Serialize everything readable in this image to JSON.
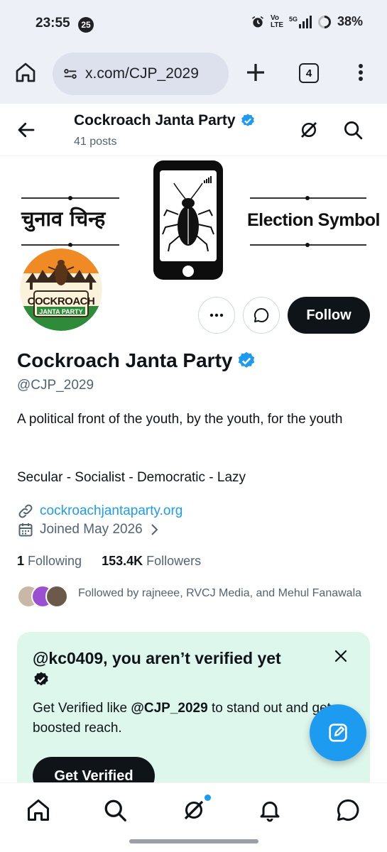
{
  "status_bar": {
    "time": "23:55",
    "notification_badge": "25",
    "network": "Vo LTE",
    "signal": "5G",
    "battery": "38%"
  },
  "browser": {
    "url": "x.com/CJP_2029",
    "tab_count": "4"
  },
  "header": {
    "name": "Cockroach Janta Party",
    "posts": "41 posts"
  },
  "banner": {
    "hindi_text": "चुनाव चिन्ह",
    "english_text": "Election Symbol"
  },
  "avatar": {
    "line1": "COCKROACH",
    "line2": "JANTA PARTY"
  },
  "actions": {
    "follow_label": "Follow"
  },
  "profile": {
    "name": "Cockroach Janta Party",
    "handle": "@CJP_2029",
    "bio": "A political front of the youth, by the youth, for the youth",
    "bio_line2": "Secular - Socialist - Democratic - Lazy",
    "website": "cockroachjantaparty.org",
    "joined": "Joined May 2026",
    "following_count": "1",
    "following_label": "Following",
    "followers_count": "153.4K",
    "followers_label": "Followers",
    "followed_by": "Followed by rajneee, RVCJ Media, and Mehul Fanawala"
  },
  "verify_card": {
    "title": "@kc0409, you aren’t verified yet",
    "desc_prefix": "Get Verified like ",
    "desc_handle": "@CJP_2029",
    "desc_suffix": " to stand out and get boosted reach.",
    "button": "Get Verified"
  },
  "colors": {
    "accent": "#1d9bf0",
    "dark": "#0f1419",
    "muted": "#536471",
    "card_bg": "#def7ec"
  }
}
